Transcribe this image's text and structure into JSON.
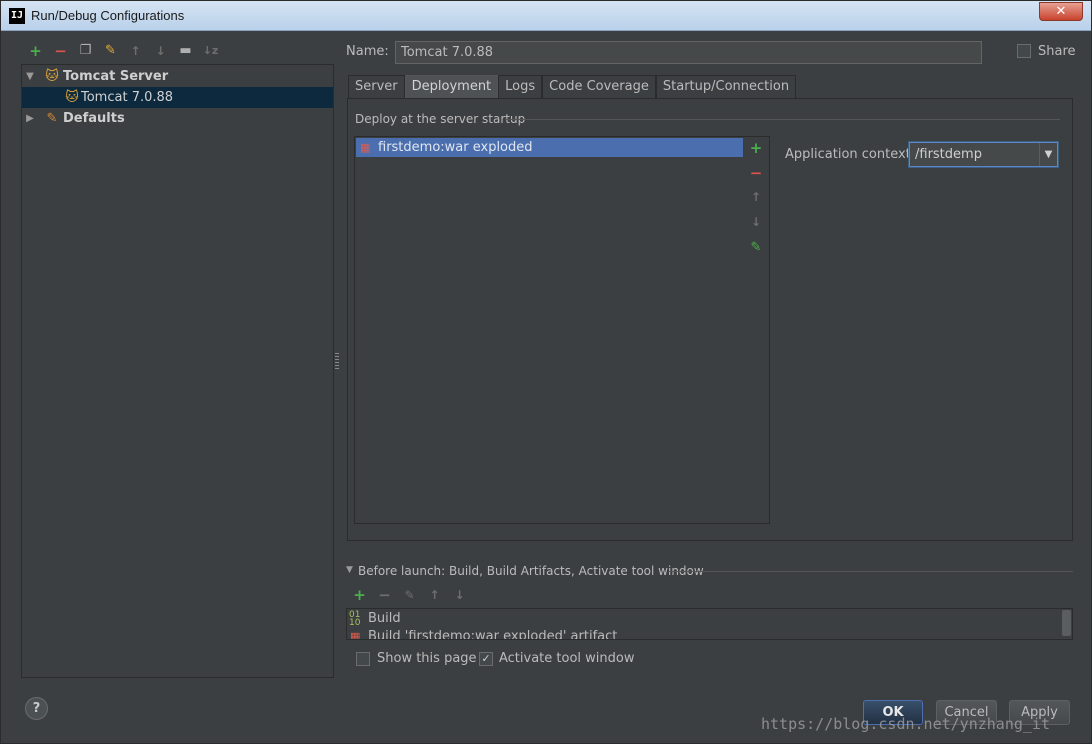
{
  "window": {
    "title": "Run/Debug Configurations",
    "close_label": "✕",
    "app_icon": "IJ"
  },
  "left_toolbar": {
    "icons": [
      "add-icon",
      "remove-icon",
      "copy-icon",
      "edit-defaults-icon",
      "move-up-icon",
      "move-down-icon",
      "folder-icon",
      "sort-icon"
    ]
  },
  "tree": {
    "items": [
      {
        "label": "Tomcat Server",
        "expanded": true,
        "bold": true
      },
      {
        "label": "Tomcat 7.0.88",
        "selected": true
      },
      {
        "label": "Defaults",
        "expanded": false,
        "bold": true
      }
    ]
  },
  "name_field": {
    "label": "Name:",
    "value": "Tomcat 7.0.88"
  },
  "share": {
    "label": "Share",
    "checked": false
  },
  "tabs": [
    {
      "label": "Server",
      "active": false
    },
    {
      "label": "Deployment",
      "active": true
    },
    {
      "label": "Logs",
      "active": false
    },
    {
      "label": "Code Coverage",
      "active": false
    },
    {
      "label": "Startup/Connection",
      "active": false
    }
  ],
  "deployment": {
    "section_title": "Deploy at the server startup",
    "items": [
      "firstdemo:war exploded"
    ],
    "app_context_label": "Application context:",
    "app_context_value": "/firstdemp"
  },
  "before_launch": {
    "title": "Before launch: Build, Build Artifacts, Activate tool window",
    "items": [
      "Build",
      "Build 'firstdemo:war exploded' artifact"
    ]
  },
  "options": {
    "show_page": {
      "label": "Show this page",
      "checked": false
    },
    "activate_tool_window": {
      "label": "Activate tool window",
      "checked": true
    }
  },
  "buttons": {
    "help": "?",
    "ok": "OK",
    "cancel": "Cancel",
    "apply": "Apply"
  },
  "watermark": "https://blog.csdn.net/ynzhang_it",
  "colors": {
    "background": "#3c3f41",
    "selection": "#4b6eaf",
    "tree_selection": "#0d293e",
    "add": "#4cae4c",
    "remove": "#d9534f"
  }
}
